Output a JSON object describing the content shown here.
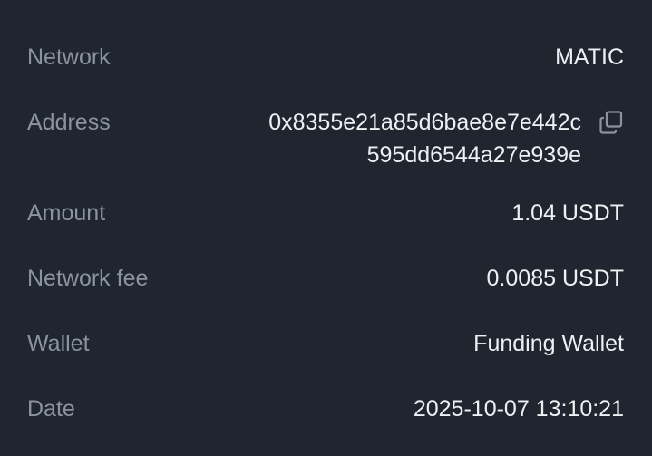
{
  "details": {
    "network": {
      "label": "Network",
      "value": "MATIC"
    },
    "address": {
      "label": "Address",
      "line1": "0x8355e21a85d6bae8e7e442c",
      "line2": "595dd6544a27e939e",
      "copy_icon": "copy-icon"
    },
    "amount": {
      "label": "Amount",
      "value": "1.04 USDT"
    },
    "network_fee": {
      "label": "Network fee",
      "value": "0.0085 USDT"
    },
    "wallet": {
      "label": "Wallet",
      "value": "Funding Wallet"
    },
    "date": {
      "label": "Date",
      "value": "2025-10-07 13:10:21"
    }
  },
  "colors": {
    "background": "#1f2630",
    "label": "#8c939d",
    "value": "#eef0f3"
  }
}
